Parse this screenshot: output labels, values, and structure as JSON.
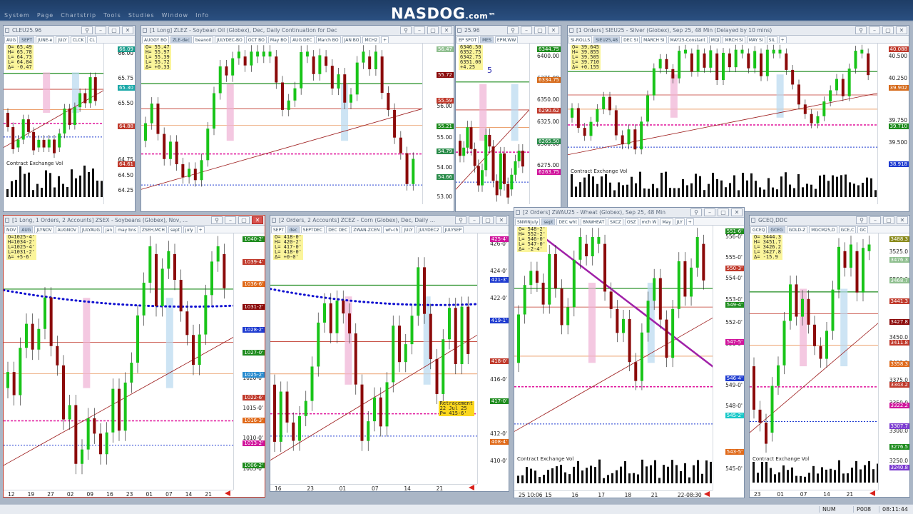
{
  "app": {
    "logo_main": "NASDOG",
    "logo_suffix": ".com",
    "logo_tm": "™",
    "menu": [
      "System",
      "Page",
      "Chartstrip",
      "Tools",
      "Studies",
      "Window",
      "Info"
    ]
  },
  "colors": {
    "up_candle": "#19c419",
    "down_candle": "#8b0a0a",
    "support_line": "#1e8c1e",
    "resistance_line": "#d7191c",
    "blue_dots": "#1010d0",
    "magenta_dash": "#e0149c",
    "highlight_box": "#e8a8d0",
    "volume": "#111111"
  },
  "windows": [
    {
      "id": "cl",
      "title": "CLEU25.96",
      "tabs": [
        "AUG",
        "SEPT",
        "JUNE-e",
        "JULY",
        "CLCK",
        "CL"
      ],
      "ohlc": [
        "O= 65.49",
        "H= 65.78",
        "L= 64.73",
        "L= 64.84",
        "Δ= -0.47"
      ],
      "ticks": [
        {
          "v": "66.00",
          "y": 0.04
        },
        {
          "v": "65.75",
          "y": 0.2
        },
        {
          "v": "65.50",
          "y": 0.36
        },
        {
          "v": "65.25",
          "y": 0.51
        },
        {
          "v": "64.75",
          "y": 0.72
        },
        {
          "v": "64.50",
          "y": 0.82
        },
        {
          "v": "64.25",
          "y": 0.92
        }
      ],
      "labels": [
        {
          "v": "66.09",
          "c": "#1a9c8c"
        },
        {
          "v": "65.30",
          "c": "#1aa8a8"
        },
        {
          "v": "64.88",
          "c": "#c0392b"
        },
        {
          "v": "64.61",
          "c": "#c0392b"
        }
      ],
      "vol_title": "Contract Exchange Vol",
      "vol_ticks": [
        "20000",
        "1670"
      ]
    },
    {
      "id": "zl",
      "title": "[1 Long] ZLEZ - Soybean Oil (Globex), Dec, Daily Continuation for Dec",
      "tabs": [
        "AUGGY BO",
        "ZLE-dec",
        "beanoil",
        "JULYDEC-BO",
        "OCT BO",
        "May BO",
        "AUG DEC",
        "March BO",
        "JAN BO",
        "MCH2",
        "+"
      ],
      "ohlc": [
        "O= 55.47",
        "H= 55.97",
        "L= 55.39",
        "L= 55.72",
        "Δ= +0.33"
      ],
      "ticks": [
        {
          "v": "57.00",
          "y": 0.18
        },
        {
          "v": "56.00",
          "y": 0.38
        },
        {
          "v": "55.00",
          "y": 0.58
        },
        {
          "v": "54.00",
          "y": 0.77
        },
        {
          "v": "53.00",
          "y": 0.96
        }
      ],
      "labels": [
        {
          "v": "56.47",
          "c": "#8fbf8f"
        },
        {
          "v": "55.72",
          "c": "#8b0a0a"
        },
        {
          "v": "55.59",
          "c": "#c0392b"
        },
        {
          "v": "55.21",
          "c": "#1e8c1e"
        },
        {
          "v": "54.79",
          "c": "#2a8c4a"
        },
        {
          "v": "54.66",
          "c": "#2a8c4a"
        }
      ]
    },
    {
      "id": "es",
      "title": "25.96",
      "tabs": [
        "EP SPOT",
        "MES",
        "EPM,WW"
      ],
      "ohlc": [
        "6346.50",
        "6352.75",
        "6342.75",
        "6351.00",
        "+4.25"
      ],
      "ticks": [
        {
          "v": "6400.00",
          "y": 0.06
        },
        {
          "v": "6375.00",
          "y": 0.2
        },
        {
          "v": "6350.00",
          "y": 0.34
        },
        {
          "v": "6325.00",
          "y": 0.48
        },
        {
          "v": "6300.00",
          "y": 0.62
        },
        {
          "v": "6275.00",
          "y": 0.76
        }
      ],
      "labels": [
        {
          "v": "6344.75",
          "c": "#1e8c1e"
        },
        {
          "v": "6334.75",
          "c": "#d66a1a"
        },
        {
          "v": "6290.62",
          "c": "#c0392b"
        },
        {
          "v": "6265.50",
          "c": "#2a8c4a"
        },
        {
          "v": "6263.75",
          "c": "#d0149c"
        }
      ],
      "annot": "5"
    },
    {
      "id": "si",
      "title": "[1 Orders] SIEU25 - Silver (Globex), Sep 25, 48 Min (Delayed by 10 mins)",
      "tabs": [
        "SI-ROLLS",
        "SIEU25,48",
        "DEC SI",
        "MARCH SI",
        "MAY25-Constant",
        "MQI",
        "MRCH SI",
        "MAY SI",
        "SIL",
        "+"
      ],
      "ohlc": [
        "O= 39.645",
        "H= 39.855",
        "L= 39.505",
        "L= 39.710",
        "Δ= +0.155"
      ],
      "ticks": [
        {
          "v": "40.500",
          "y": 0.06
        },
        {
          "v": "40.250",
          "y": 0.2
        },
        {
          "v": "39.750",
          "y": 0.47
        },
        {
          "v": "39.500",
          "y": 0.61
        },
        {
          "v": "39.250",
          "y": 0.75
        }
      ],
      "labels": [
        {
          "v": "40.088",
          "c": "#c0392b"
        },
        {
          "v": "39.902",
          "c": "#d66a1a"
        },
        {
          "v": "39.710",
          "c": "#1e8c1e"
        },
        {
          "v": "38.918",
          "c": "#1e3bd0"
        }
      ],
      "vol_title": "Contract Exchange Vol",
      "vol_ticks": [
        "10000",
        "3183"
      ]
    },
    {
      "id": "zs",
      "title": "[1 Long, 1 Orders, 2 Accounts] ZSEX - Soybeans (Globex), Nov, ...",
      "tabs": [
        "NOV",
        "AUG",
        "JLYNOV",
        "AUGNOV",
        "JULYAUG",
        "jan",
        "may bns",
        "ZSEH,MCH",
        "sept",
        "july",
        "+"
      ],
      "ohlc": [
        "O=1025-4'",
        "H=1034-2'",
        "L=1025-4'",
        "L=1031-2'",
        "Δ= +5-6'"
      ],
      "ticks": [
        {
          "v": "1020-0'",
          "y": 0.56
        },
        {
          "v": "1015-0'",
          "y": 0.68
        },
        {
          "v": "1010-0'",
          "y": 0.8
        },
        {
          "v": "1005-0'",
          "y": 0.92
        }
      ],
      "labels": [
        {
          "v": "1040-2'",
          "c": "#1e8c1e"
        },
        {
          "v": "1039-4'",
          "c": "#c0392b"
        },
        {
          "v": "1036-6'",
          "c": "#e06a1a"
        },
        {
          "v": "1031-2'",
          "c": "#8b0a0a"
        },
        {
          "v": "1028-2'",
          "c": "#1e3bd0"
        },
        {
          "v": "1027-0'",
          "c": "#1e8c1e"
        },
        {
          "v": "1025-2'",
          "c": "#2a8ccf"
        },
        {
          "v": "1022-6'",
          "c": "#c0392b"
        },
        {
          "v": "1016-3'",
          "c": "#e06a1a"
        },
        {
          "v": "1013-2'",
          "c": "#d0149c"
        },
        {
          "v": "1006-2'",
          "c": "#1e8c1e"
        }
      ],
      "dates": [
        "12",
        "19",
        "27",
        "02",
        "09",
        "16",
        "23",
        "01",
        "07",
        "14",
        "21"
      ],
      "months": [
        "Jun",
        "Jul"
      ]
    },
    {
      "id": "zc",
      "title": "[2 Orders, 2 Accounts] ZCEZ - Corn (Globex), Dec, Daily ...",
      "tabs": [
        "SEPT",
        "dec",
        "SEPTDEC",
        "DEC DEC",
        "ZWAN-ZCEN",
        "wh-ch",
        "JULY",
        "JULYDEC2",
        "JULYSEP"
      ],
      "ohlc": [
        "O= 418-0'",
        "H= 420-2'",
        "L= 417-0'",
        "L= 418-0'",
        "Δ= +0-0'"
      ],
      "ticks": [
        {
          "v": "426-0'",
          "y": 0.03
        },
        {
          "v": "424-0'",
          "y": 0.14
        },
        {
          "v": "422-0'",
          "y": 0.25
        },
        {
          "v": "416-0'",
          "y": 0.58
        },
        {
          "v": "412-0'",
          "y": 0.8
        },
        {
          "v": "410-0'",
          "y": 0.91
        }
      ],
      "labels": [
        {
          "v": "425-4'",
          "c": "#d0149c"
        },
        {
          "v": "421-3'",
          "c": "#1e3bd0"
        },
        {
          "v": "419-1'",
          "c": "#1e3bd0"
        },
        {
          "v": "418-0'",
          "c": "#c0392b"
        },
        {
          "v": "417-0'",
          "c": "#1e8c1e"
        },
        {
          "v": "408-4'",
          "c": "#e06a1a"
        }
      ],
      "retrace": [
        "Retracement",
        "22 Jul 25",
        "P= 415-6'"
      ],
      "dates": [
        "16",
        "23",
        "01",
        "07",
        "14",
        "21"
      ],
      "months": [
        "Jul"
      ]
    },
    {
      "id": "zw",
      "title": "[2 Orders] ZWAU25 - Wheat (Globex), Sep 25, 48 Min",
      "tabs": [
        "SNWNjuly",
        "sept",
        "DEC wht",
        "BNWHEAT",
        "SXCZ",
        "OSZ",
        "mch W",
        "May",
        "JLY",
        "+"
      ],
      "ohlc": [
        "O= 548-2'",
        "H= 552-2'",
        "L= 546-0'",
        "L= 547-0'",
        "Δ= -2-4'"
      ],
      "ticks": [
        {
          "v": "556-0'",
          "y": 0.03
        },
        {
          "v": "555-0'",
          "y": 0.11
        },
        {
          "v": "554-0'",
          "y": 0.19
        },
        {
          "v": "553-0'",
          "y": 0.27
        },
        {
          "v": "552-0'",
          "y": 0.36
        },
        {
          "v": "551-0'",
          "y": 0.44
        },
        {
          "v": "549-0'",
          "y": 0.6
        },
        {
          "v": "548-0'",
          "y": 0.68
        },
        {
          "v": "545-0'",
          "y": 0.92
        }
      ],
      "labels": [
        {
          "v": "551-6'",
          "c": "#1e8c1e"
        },
        {
          "v": "550-3'",
          "c": "#c0392b"
        },
        {
          "v": "549-4'",
          "c": "#1e8c1e"
        },
        {
          "v": "547-5'",
          "c": "#d0149c"
        },
        {
          "v": "546-4'",
          "c": "#1e3bd0"
        },
        {
          "v": "545-2'",
          "c": "#18c8c8"
        },
        {
          "v": "543-5'",
          "c": "#e06a1a"
        }
      ],
      "vol_title": "Contract Exchange Vol",
      "vol_ticks": [
        "25000",
        "20000",
        "14806",
        "10000"
      ],
      "dates": [
        "25 10:06",
        "15",
        "16",
        "17",
        "18",
        "21",
        "22-08:30"
      ]
    },
    {
      "id": "gc",
      "title": "GCEQ,DDC",
      "tabs": [
        "GCEQ",
        "GCEG",
        "GOLD-Z",
        "MGCM25,D",
        "GCE,C",
        "GC"
      ],
      "ohlc": [
        "O= 3444.3",
        "H= 3451.7",
        "L= 3426.2",
        "L= 3427.8",
        "Δ= -15.9"
      ],
      "ticks": [
        {
          "v": "3539.3",
          "y": 0.01
        },
        {
          "v": "3525.0",
          "y": 0.06
        },
        {
          "v": "3500.0",
          "y": 0.17
        },
        {
          "v": "3450.0",
          "y": 0.4
        },
        {
          "v": "3400.0",
          "y": 0.5
        },
        {
          "v": "3375.0",
          "y": 0.57
        },
        {
          "v": "3350.0",
          "y": 0.66
        },
        {
          "v": "3300.0",
          "y": 0.77
        },
        {
          "v": "3250.0",
          "y": 0.89
        }
      ],
      "labels": [
        {
          "v": "3488.3",
          "c": "#8a8a1a"
        },
        {
          "v": "3476.3",
          "c": "#8fbf8f"
        },
        {
          "v": "3468.7",
          "c": "#8fbf8f"
        },
        {
          "v": "3441.3",
          "c": "#c0392b"
        },
        {
          "v": "3427.8",
          "c": "#8b0a0a"
        },
        {
          "v": "3411.8",
          "c": "#c0392b"
        },
        {
          "v": "3358.3",
          "c": "#e06a1a"
        },
        {
          "v": "3343.2",
          "c": "#c0392b"
        },
        {
          "v": "3322.2",
          "c": "#d0149c"
        },
        {
          "v": "3307.7",
          "c": "#7b3bd0"
        },
        {
          "v": "3276.5",
          "c": "#1e8c1e"
        },
        {
          "v": "3240.8",
          "c": "#7b3bd0"
        }
      ],
      "vol_title": "Contract Exchange Vol",
      "vol_ticks": [
        "300000",
        "200000",
        "109419",
        "100000"
      ],
      "dates": [
        "23",
        "01",
        "07",
        "14",
        "21"
      ],
      "months": [
        "Jul"
      ]
    }
  ],
  "status": {
    "num": "NUM",
    "page": "P008",
    "time": "08:11:44"
  }
}
